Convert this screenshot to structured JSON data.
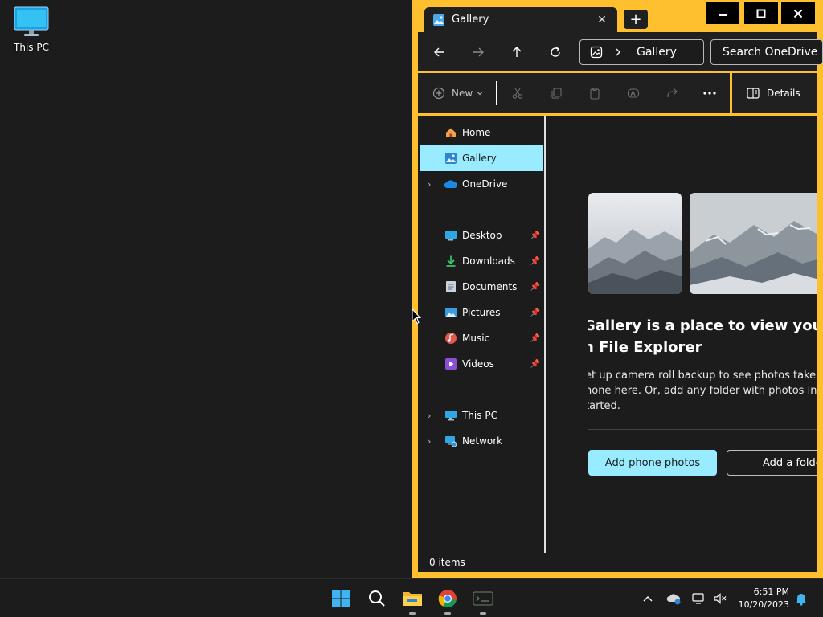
{
  "desktop": {
    "icon_label": "This PC"
  },
  "window": {
    "tab_title": "Gallery",
    "new_tab_symbol": "+",
    "controls": {
      "minimize": "minimize-icon",
      "maximize": "maximize-icon",
      "close": "close-icon"
    }
  },
  "navbar": {
    "address_crumb": "Gallery",
    "search_placeholder": "Search OneDrive"
  },
  "commandbar": {
    "new_label": "New",
    "details_label": "Details"
  },
  "sidebar": {
    "items": [
      {
        "label": "Home",
        "icon": "home-icon"
      },
      {
        "label": "Gallery",
        "icon": "gallery-icon",
        "selected": true
      },
      {
        "label": "OneDrive",
        "icon": "onedrive-icon"
      },
      {
        "label": "Desktop",
        "icon": "desktop-icon",
        "pinned": true
      },
      {
        "label": "Downloads",
        "icon": "downloads-icon",
        "pinned": true
      },
      {
        "label": "Documents",
        "icon": "documents-icon",
        "pinned": true
      },
      {
        "label": "Pictures",
        "icon": "pictures-icon",
        "pinned": true
      },
      {
        "label": "Music",
        "icon": "music-icon",
        "pinned": true
      },
      {
        "label": "Videos",
        "icon": "videos-icon",
        "pinned": true
      },
      {
        "label": "This PC",
        "icon": "this-pc-icon"
      },
      {
        "label": "Network",
        "icon": "network-icon"
      }
    ]
  },
  "main": {
    "headline_line1": "Gallery is a place to view your ph",
    "headline_line2": "n File Explorer",
    "desc_line1": "et up camera roll backup to see photos taken o",
    "desc_line2": "hone here. Or, add any folder with photos in it",
    "desc_line3": "tarted.",
    "primary_button": "Add phone photos",
    "secondary_button": "Add a folde"
  },
  "status": {
    "items_count": "0 items"
  },
  "taskbar": {
    "clock_time": "6:51 PM",
    "clock_date": "10/20/2023"
  },
  "colors": {
    "accent": "#fec02e",
    "selection": "#99ebff",
    "window_bg": "#1c1c1c"
  }
}
